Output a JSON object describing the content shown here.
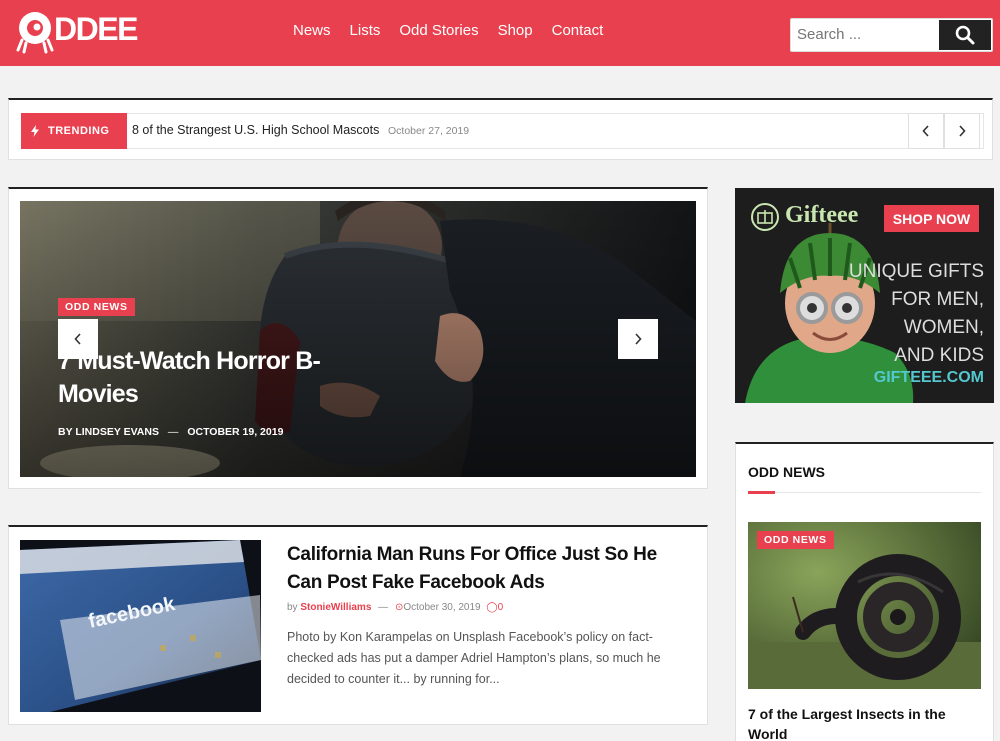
{
  "site": {
    "logo_text": "ODDEE"
  },
  "nav": {
    "items": [
      {
        "label": "News"
      },
      {
        "label": "Lists"
      },
      {
        "label": "Odd Stories"
      },
      {
        "label": "Shop"
      },
      {
        "label": "Contact"
      }
    ]
  },
  "search": {
    "placeholder": "Search ..."
  },
  "trending": {
    "label": "TRENDING",
    "title": "8 of the Strangest U.S. High School Mascots",
    "date": "October 27, 2019"
  },
  "featured": {
    "category": "ODD NEWS",
    "title": "7 Must-Watch Horror B-Movies",
    "by": "BY",
    "author": "LINDSEY EVANS",
    "dash": "—",
    "date": "OCTOBER 19, 2019"
  },
  "article": {
    "title": "California Man Runs For Office Just So He Can Post Fake Facebook Ads",
    "by": "by",
    "author": "StonieWilliams",
    "dash": "—",
    "date": "October 30, 2019",
    "comments": "0",
    "excerpt": "Photo by Kon Karampelas on Unsplash    Facebook’s policy on fact-checked ads has put a damper Adriel Hampton’s plans, so much he decided to counter it... by running for..."
  },
  "ad": {
    "brand": "Gifteee",
    "cta": "SHOP NOW",
    "tagline_1": "UNIQUE GIFTS",
    "tagline_2": "FOR MEN,",
    "tagline_3": "WOMEN,",
    "tagline_4": "AND KIDS",
    "url": "GIFTEEE.COM"
  },
  "widget": {
    "title": "ODD NEWS",
    "post": {
      "category": "ODD NEWS",
      "title": "7 of the Largest Insects in the World"
    }
  },
  "colors": {
    "brand_red": "#e8404f",
    "dark": "#222222",
    "ad_teal": "#53c9cf"
  },
  "icons": [
    "bolt-icon",
    "search-icon",
    "chevron-left-icon",
    "chevron-right-icon",
    "clock-icon",
    "comment-icon"
  ]
}
